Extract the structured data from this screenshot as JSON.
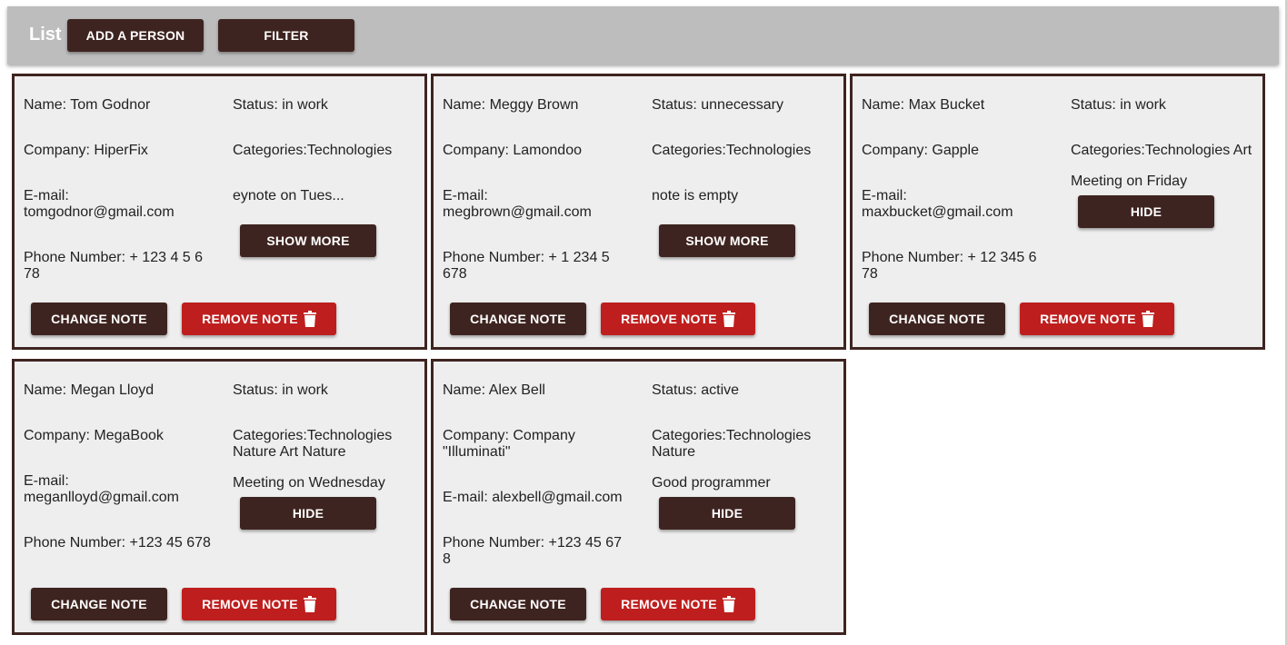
{
  "header": {
    "title": "List",
    "add_person_label": "ADD A PERSON",
    "filter_label": "FILTER"
  },
  "actions": {
    "change_note_label": "CHANGE NOTE",
    "remove_note_label": "REMOVE NOTE",
    "show_more_label": "SHOW MORE",
    "hide_label": "HIDE"
  },
  "cards": [
    {
      "name": "Name: Tom Godnor",
      "status": "Status: in work",
      "company": "Company: HiperFix",
      "categories": "Categories:Technologies",
      "email": "E-mail: tomgodnor@gmail.com",
      "note": "eynote on Tues...",
      "phone": "Phone Number: + 123 4 5 6 78",
      "note_toggle": "SHOW MORE"
    },
    {
      "name": "Name: Meggy Brown",
      "status": "Status: unnecessary",
      "company": "Company: Lamondoo",
      "categories": "Categories:Technologies",
      "email": "E-mail: megbrown@gmail.com",
      "note": "note is empty",
      "phone": "Phone Number: + 1 234 5 678",
      "note_toggle": "SHOW MORE"
    },
    {
      "name": "Name: Max Bucket",
      "status": "Status: in work",
      "company": "Company: Gapple",
      "categories": "Categories:Technologies Art",
      "email": "E-mail: maxbucket@gmail.com",
      "note": "Meeting on Friday",
      "phone": "Phone Number: + 12 345 6 78",
      "note_toggle": "HIDE"
    },
    {
      "name": "Name: Megan Lloyd",
      "status": "Status: in work",
      "company": "Company: MegaBook",
      "categories": "Categories:Technologies Nature Art Nature",
      "email": "E-mail: meganlloyd@gmail.com",
      "note": "Meeting on Wednesday",
      "phone": "Phone Number: +123 45 678",
      "note_toggle": "HIDE"
    },
    {
      "name": "Name: Alex Bell",
      "status": "Status: active",
      "company": "Company: Company \"Illuminati\"",
      "categories": "Categories:Technologies Nature",
      "email": "E-mail: alexbell@gmail.com",
      "note": "Good programmer",
      "phone": "Phone Number: +123 45 67 8",
      "note_toggle": "HIDE"
    }
  ],
  "colors": {
    "header_bg": "#bdbdbd",
    "dark_button": "#3e2420",
    "remove_button": "#bf1e1e",
    "card_bg": "#eeeeee",
    "card_border": "#3e2420"
  },
  "icons": {
    "remove_icon": "trash-icon"
  }
}
